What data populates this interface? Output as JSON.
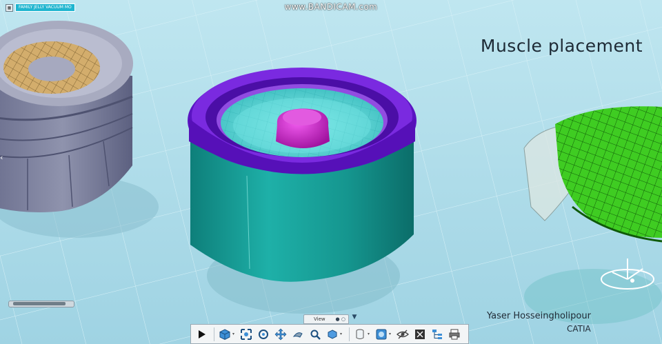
{
  "app": {
    "watermark": "www.BANDICAM.com",
    "tree_tab_label": "FAMILY JELLY VACUUM MO",
    "step_title": "Muscle placement",
    "author": "Yaser Hosseingholipour",
    "software": "CATIA"
  },
  "view_tab": {
    "label": "View"
  },
  "toolbar": {
    "tools": [
      {
        "name": "play-icon"
      },
      {
        "name": "cube-view-icon"
      },
      {
        "name": "fit-all-icon"
      },
      {
        "name": "rotate-icon"
      },
      {
        "name": "pan-icon"
      },
      {
        "name": "fly-icon"
      },
      {
        "name": "zoom-icon"
      },
      {
        "name": "iso-view-icon"
      },
      {
        "name": "cylinder-view-icon"
      },
      {
        "name": "render-style-icon"
      },
      {
        "name": "hide-show-icon"
      },
      {
        "name": "swap-visible-icon"
      },
      {
        "name": "tree-layout-icon"
      },
      {
        "name": "print-icon"
      }
    ]
  },
  "colors": {
    "background": "#a9dbe8",
    "mold_teal": "#1aa39c",
    "mold_purple": "#6b1ed0",
    "core_magenta": "#c61cc9",
    "gray_part": "#8a8ea8",
    "green_part": "#39c51c",
    "accent": "#1fb5cf"
  }
}
